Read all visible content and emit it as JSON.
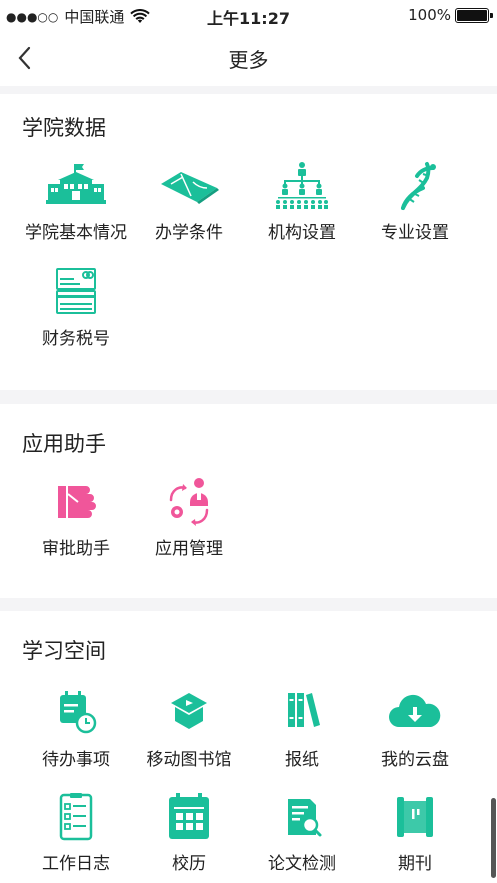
{
  "status_bar": {
    "carrier": "中国联通",
    "time": "上午11:27",
    "battery_pct": "100%"
  },
  "nav": {
    "title": "更多",
    "back_icon": "chevron-left-icon"
  },
  "sections": [
    {
      "title": "学院数据",
      "items": [
        {
          "label": "学院基本情况",
          "icon": "school-building-icon"
        },
        {
          "label": "办学条件",
          "icon": "field-map-icon"
        },
        {
          "label": "机构设置",
          "icon": "org-chart-icon"
        },
        {
          "label": "专业设置",
          "icon": "dna-icon"
        },
        {
          "label": "财务税号",
          "icon": "finance-card-icon"
        }
      ]
    },
    {
      "title": "应用助手",
      "items": [
        {
          "label": "审批助手",
          "icon": "hand-stamp-icon"
        },
        {
          "label": "应用管理",
          "icon": "app-manage-icon"
        }
      ]
    },
    {
      "title": "学习空间",
      "items": [
        {
          "label": "待办事项",
          "icon": "calendar-clock-icon"
        },
        {
          "label": "移动图书馆",
          "icon": "mobile-library-icon"
        },
        {
          "label": "报纸",
          "icon": "books-icon"
        },
        {
          "label": "我的云盘",
          "icon": "cloud-download-icon"
        },
        {
          "label": "工作日志",
          "icon": "clipboard-list-icon"
        },
        {
          "label": "校历",
          "icon": "calendar-grid-icon"
        },
        {
          "label": "论文检测",
          "icon": "document-search-icon"
        },
        {
          "label": "期刊",
          "icon": "scroll-icon"
        }
      ]
    }
  ],
  "colors": {
    "teal": "#1bbf9a",
    "pink": "#f0569a",
    "divider": "#f4f4f6"
  }
}
